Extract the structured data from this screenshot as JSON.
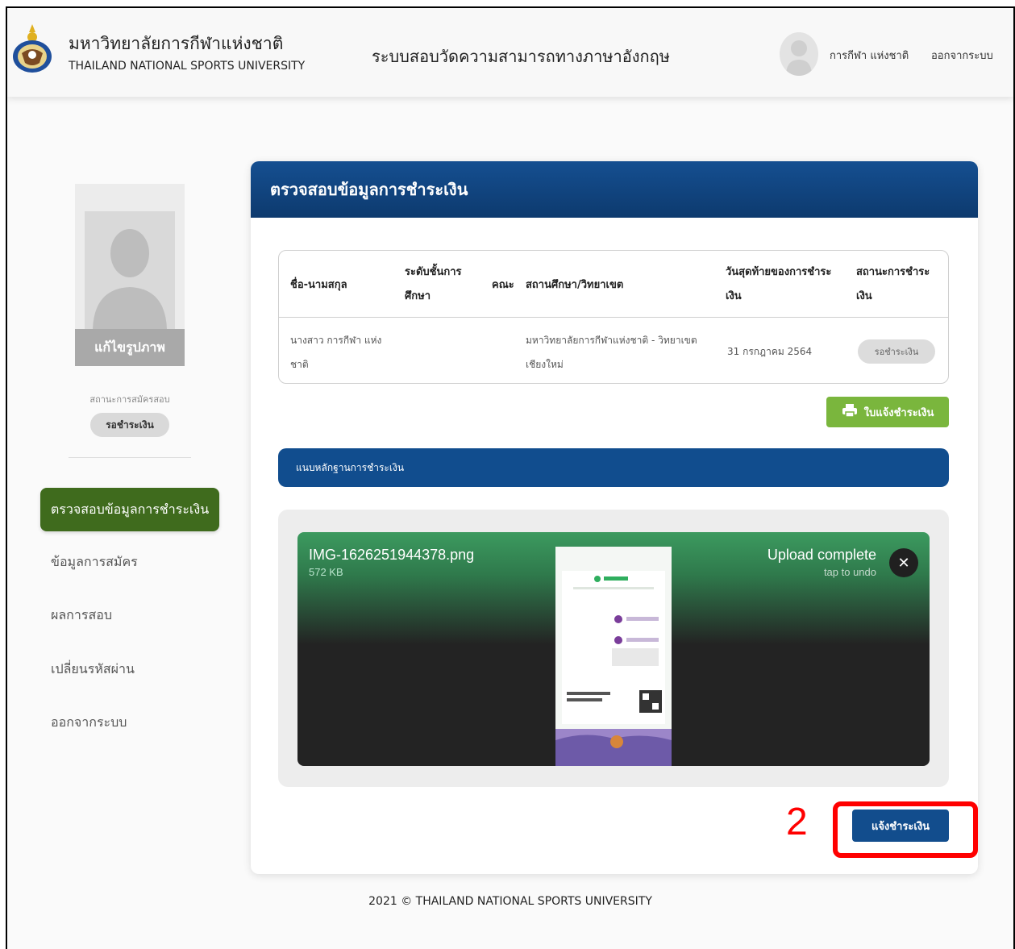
{
  "header": {
    "university_th": "มหาวิทยาลัยการกีฬาแห่งชาติ",
    "university_en": "THAILAND NATIONAL SPORTS UNIVERSITY",
    "system_title": "ระบบสอบวัดความสามารถทางภาษาอังกฤษ",
    "user_name": "การกีฬา แห่งชาติ",
    "logout_label": "ออกจากระบบ"
  },
  "sidebar": {
    "edit_photo_label": "แก้ไขรูปภาพ",
    "reg_status_label": "สถานะการสมัครสอบ",
    "reg_status_value": "รอชำระเงิน",
    "active_item": "ตรวจสอบข้อมูลการชำระเงิน",
    "items": [
      {
        "label": "ข้อมูลการสมัคร"
      },
      {
        "label": "ผลการสอบ"
      },
      {
        "label": "เปลี่ยนรหัสผ่าน"
      },
      {
        "label": "ออกจากระบบ"
      }
    ]
  },
  "main": {
    "title": "ตรวจสอบข้อมูลการชำระเงิน",
    "table": {
      "headers": {
        "name": "ชื่อ-นามสกุล",
        "level_1": "ระดับชั้นการ",
        "level_2": "ศึกษา",
        "faculty": "คณะ",
        "institute": "สถานศึกษา/วิทยาเขต",
        "deadline_1": "วันสุดท้ายของการชำระ",
        "deadline_2": "เงิน",
        "status_1": "สถานะการชำระ",
        "status_2": "เงิน"
      },
      "row": {
        "name_1": "นางสาว การกีฬา แห่ง",
        "name_2": "ชาติ",
        "level": "",
        "faculty": "",
        "institute_1": "มหาวิทยาลัยการกีฬาแห่งชาติ - วิทยาเขต",
        "institute_2": "เชียงใหม่",
        "deadline": "31 กรกฎาคม 2564",
        "status": "รอชำระเงิน"
      }
    },
    "invoice_button": "ใบแจ้งชำระเงิน",
    "attach_section_title": "แนบหลักฐานการชำระเงิน",
    "upload": {
      "file_name": "IMG-1626251944378.png",
      "file_size": "572 KB",
      "status": "Upload complete",
      "undo_hint": "tap to undo"
    },
    "submit_button": "แจ้งชำระเงิน"
  },
  "annotation": {
    "step_number": "2"
  },
  "footer": {
    "text": "2021 © THAILAND NATIONAL SPORTS UNIVERSITY"
  },
  "colors": {
    "header_blue": "#154f91",
    "nav_active_green": "#3f6b1d",
    "invoice_green": "#7ab63d",
    "annotation_red": "#ff0000"
  }
}
